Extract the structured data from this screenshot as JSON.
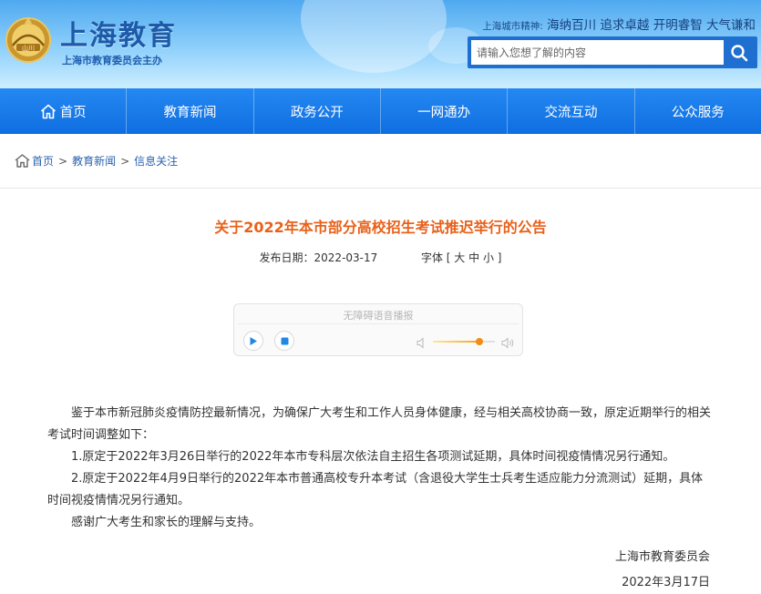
{
  "header": {
    "site_title": "上海教育",
    "site_subtitle": "上海市教育委员会主办",
    "spirit_label": "上海城市精神:",
    "spirit_text": "海纳百川 追求卓越 开明睿智 大气谦和",
    "search": {
      "placeholder": "请输入您想了解的内容"
    },
    "emblem_text": "山川"
  },
  "nav": {
    "items": [
      {
        "label": "首页",
        "icon": "home-icon"
      },
      {
        "label": "教育新闻"
      },
      {
        "label": "政务公开"
      },
      {
        "label": "一网通办"
      },
      {
        "label": "交流互动"
      },
      {
        "label": "公众服务"
      }
    ]
  },
  "breadcrumb": {
    "items": [
      "首页",
      "教育新闻",
      "信息关注"
    ],
    "separator": ">"
  },
  "article": {
    "title": "关于2022年本市部分高校招生考试推迟举行的公告",
    "publish_label": "发布日期：",
    "publish_date": "2022-03-17",
    "font_label": "字体 [",
    "font_large": "大",
    "font_medium": "中",
    "font_small": "小",
    "font_close": "]",
    "player": {
      "label": "无障碍语音播报",
      "volume_fraction": 0.75
    },
    "paragraphs": [
      "鉴于本市新冠肺炎疫情防控最新情况，为确保广大考生和工作人员身体健康，经与相关高校协商一致，原定近期举行的相关考试时间调整如下：",
      "1.原定于2022年3月26日举行的2022年本市专科层次依法自主招生各项测试延期，具体时间视疫情情况另行通知。",
      "2.原定于2022年4月9日举行的2022年本市普通高校专升本考试（含退役大学生士兵考生适应能力分流测试）延期，具体时间视疫情情况另行通知。",
      "感谢广大考生和家长的理解与支持。"
    ],
    "signature": "上海市教育委员会",
    "sign_date": "2022年3月17日"
  },
  "colors": {
    "nav_blue": "#1579e8",
    "title_orange": "#e8611a",
    "link_blue": "#2b63ad"
  }
}
